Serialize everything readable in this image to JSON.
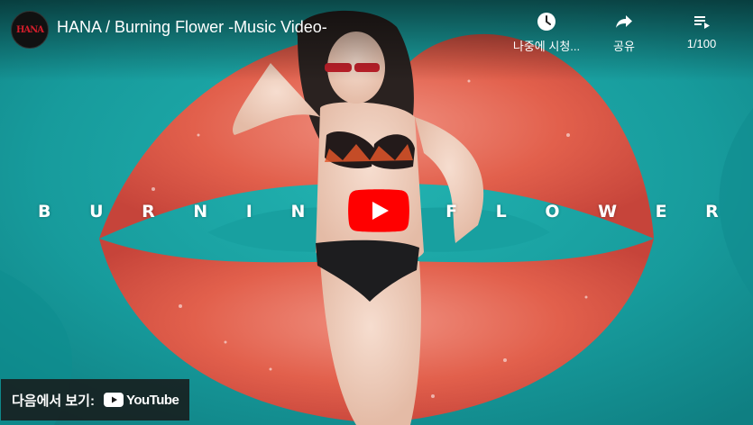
{
  "video": {
    "title": "HANA / Burning Flower -Music Video-",
    "channel_avatar_text": "HANA"
  },
  "actions": {
    "watch_later": {
      "label": "나중에 시청...",
      "icon": "clock-icon"
    },
    "share": {
      "label": "공유",
      "icon": "share-arrow-icon"
    },
    "playlist": {
      "label": "1/100",
      "icon": "playlist-icon"
    }
  },
  "overlay_letters": [
    "B",
    "U",
    "R",
    "N",
    "I",
    "N",
    "",
    "",
    "F",
    "L",
    "O",
    "W",
    "E",
    "R"
  ],
  "watch_on": {
    "label": "다음에서 보기:",
    "logo_text": "YouTube"
  },
  "colors": {
    "play_red": "#ff0000",
    "pool": "#1ba3a3",
    "lips": "#e25a4a"
  }
}
